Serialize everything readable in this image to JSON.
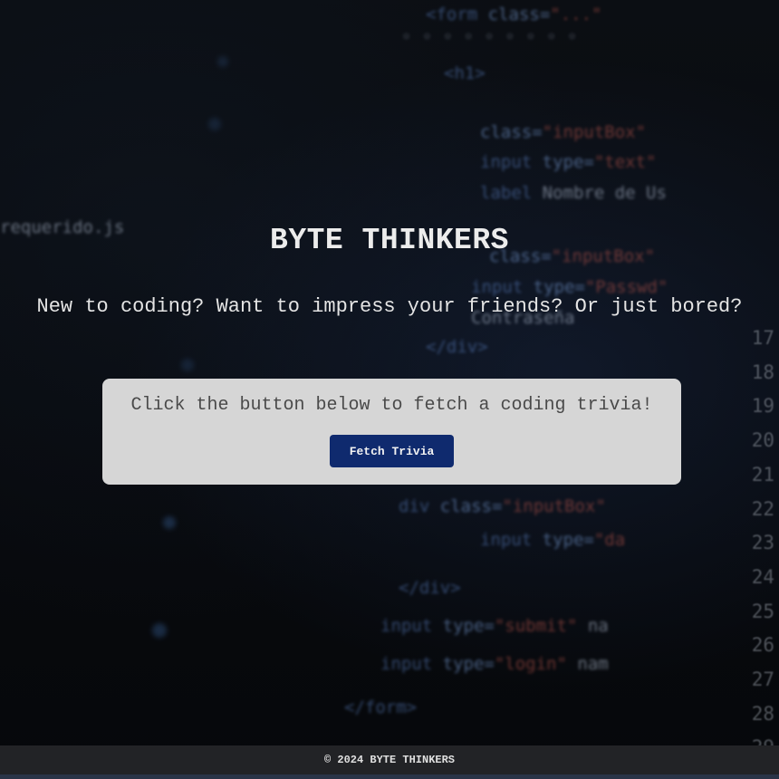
{
  "header": {
    "title": "BYTE THINKERS",
    "tagline": "New to coding? Want to impress your friends? Or just bored?"
  },
  "trivia_card": {
    "prompt": "Click the button below to fetch a coding trivia!",
    "button_label": "Fetch Trivia"
  },
  "footer": {
    "text": "© 2024 BYTE THINKERS"
  },
  "colors": {
    "button_bg": "#0f2a6e",
    "card_bg": "#d6d6d6",
    "footer_bg": "#222326"
  }
}
